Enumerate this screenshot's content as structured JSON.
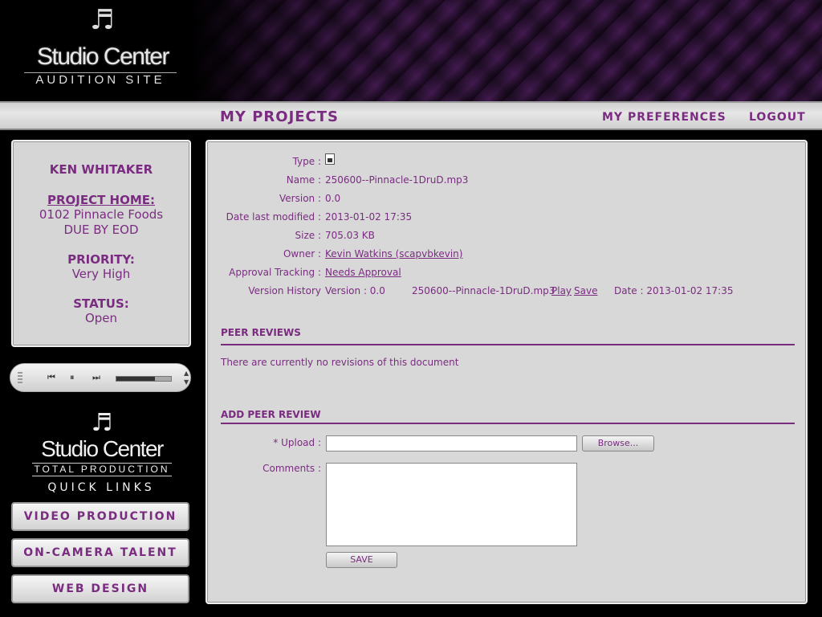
{
  "header": {
    "logo_mark": "Studio Center",
    "logo_sub": "AUDITION SITE"
  },
  "nav": {
    "projects": "MY PROJECTS",
    "preferences": "MY PREFERENCES",
    "logout": "LOGOUT"
  },
  "sidebar": {
    "user_name": "KEN WHITAKER",
    "project_home_label": "PROJECT HOME:",
    "project_home_line1": "0102 Pinnacle Foods",
    "project_home_line2": "DUE BY EOD",
    "priority_label": "PRIORITY:",
    "priority_value": "Very High",
    "status_label": "STATUS:",
    "status_value": "Open",
    "player": {
      "progress": 0.3
    },
    "logo2_mark": "Studio Center",
    "logo2_sub": "TOTAL PRODUCTION",
    "quick_links_title": "QUICK LINKS",
    "quick_links": [
      "VIDEO PRODUCTION",
      "ON-CAMERA TALENT",
      "WEB DESIGN"
    ]
  },
  "file": {
    "type_label": "Type :",
    "type_icon": "audio-document-icon",
    "name_label": "Name :",
    "name_value": "250600--Pinnacle-1DruD.mp3",
    "version_label": "Version :",
    "version_value": "0.0",
    "modified_label": "Date last modified :",
    "modified_value": "2013-01-02 17:35",
    "size_label": "Size :",
    "size_value": "705.03 KB",
    "owner_label": "Owner :",
    "owner_value": "Kevin Watkins (scapvbkevin)",
    "approval_label": "Approval Tracking :",
    "approval_value": "Needs Approval",
    "history_label": "Version History",
    "history_version": "Version : 0.0",
    "history_file": "250600--Pinnacle-1DruD.mp3",
    "history_play": "Play",
    "history_save": "Save",
    "history_date": "Date : 2013-01-02 17:35"
  },
  "peer_reviews": {
    "title": "PEER REVIEWS",
    "empty_message": "There are currently no revisions of this document"
  },
  "add_review": {
    "title": "ADD PEER REVIEW",
    "upload_label": "* Upload :",
    "browse_label": "Browse...",
    "comments_label": "Comments :",
    "save_label": "SAVE"
  },
  "colors": {
    "accent": "#7a2c80",
    "panel": "#d8d8d8",
    "background": "#000000"
  }
}
